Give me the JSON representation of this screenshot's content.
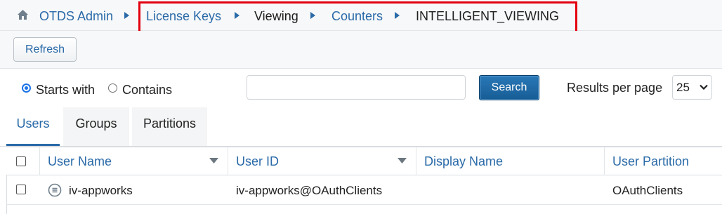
{
  "breadcrumb": {
    "home_label": "OTDS Admin",
    "items": [
      {
        "label": "License Keys"
      },
      {
        "label": "Viewing"
      },
      {
        "label": "Counters"
      },
      {
        "label": "INTELLIGENT_VIEWING"
      }
    ]
  },
  "toolbar": {
    "refresh_label": "Refresh"
  },
  "search": {
    "mode_starts_with": "Starts with",
    "mode_contains": "Contains",
    "selected_mode": "Starts with",
    "query_value": "",
    "search_label": "Search",
    "results_per_page_label": "Results per page",
    "results_per_page_value": "25"
  },
  "tabs": [
    {
      "label": "Users",
      "active": true
    },
    {
      "label": "Groups",
      "active": false
    },
    {
      "label": "Partitions",
      "active": false
    }
  ],
  "table": {
    "columns": [
      {
        "label": "User Name",
        "sortable": true
      },
      {
        "label": "User ID",
        "sortable": true
      },
      {
        "label": "Display Name",
        "sortable": false
      },
      {
        "label": "User Partition",
        "sortable": false
      }
    ],
    "rows": [
      {
        "user_name": "iv-appworks",
        "user_id": "iv-appworks@OAuthClients",
        "display_name": "",
        "user_partition": "OAuthClients"
      }
    ]
  },
  "colors": {
    "link": "#2a6aa8",
    "highlight": "#e3000f",
    "primary_button": "#175d95"
  }
}
